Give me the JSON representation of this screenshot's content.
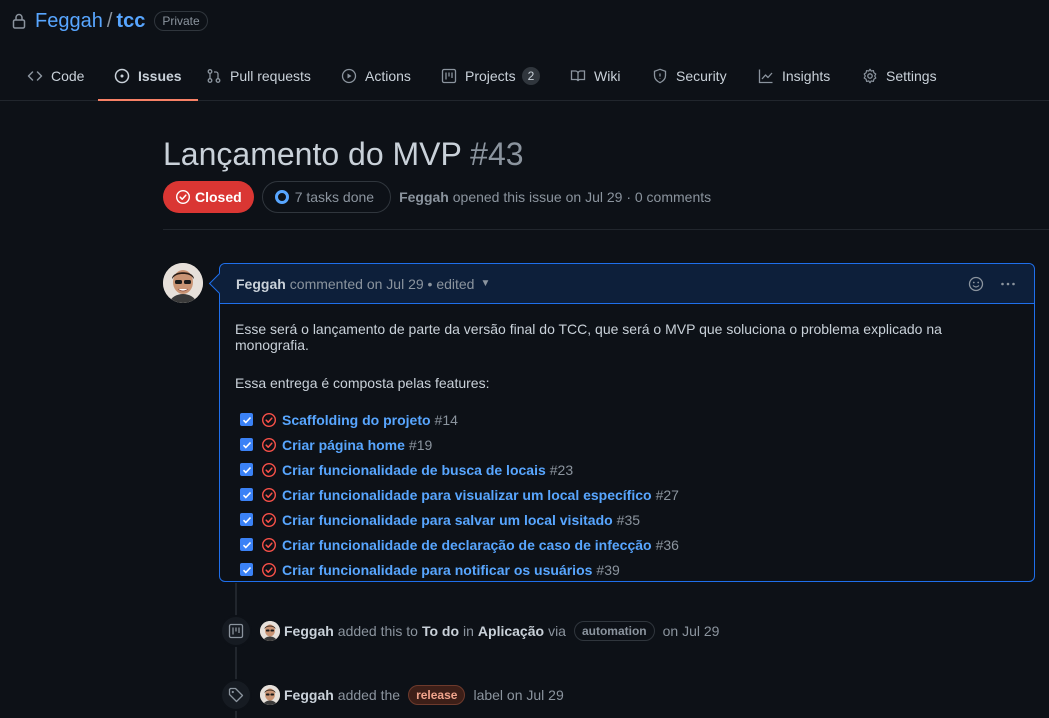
{
  "repo": {
    "owner": "Feggah",
    "separator": "/",
    "name": "tcc",
    "visibility": "Private"
  },
  "nav": {
    "tabs": [
      {
        "label": "Code",
        "icon": "code-icon"
      },
      {
        "label": "Issues",
        "icon": "issue-opened-icon",
        "active": true
      },
      {
        "label": "Pull requests",
        "icon": "git-pull-request-icon"
      },
      {
        "label": "Actions",
        "icon": "play-icon"
      },
      {
        "label": "Projects",
        "icon": "project-icon",
        "count": "2"
      },
      {
        "label": "Wiki",
        "icon": "book-icon"
      },
      {
        "label": "Security",
        "icon": "shield-icon"
      },
      {
        "label": "Insights",
        "icon": "graph-icon"
      },
      {
        "label": "Settings",
        "icon": "gear-icon"
      }
    ]
  },
  "issue": {
    "title": "Lançamento do MVP",
    "number": "#43",
    "state": "Closed",
    "tasks": "7 tasks done",
    "author": "Feggah",
    "opened_text": "opened this issue on Jul 29 · 0 comments"
  },
  "comment": {
    "author": "Feggah",
    "when": "commented on Jul 29 • edited",
    "paragraph1": "Esse será o lançamento de parte da versão final do TCC, que será o MVP que soluciona o problema explicado na monografia.",
    "paragraph2": "Essa entrega é composta pelas features:",
    "tasks": [
      {
        "label": "Scaffolding do projeto",
        "ref": "#14"
      },
      {
        "label": "Criar página home",
        "ref": "#19"
      },
      {
        "label": "Criar funcionalidade de busca de locais",
        "ref": "#23"
      },
      {
        "label": "Criar funcionalidade para visualizar um local específico",
        "ref": "#27"
      },
      {
        "label": "Criar funcionalidade para salvar um local visitado",
        "ref": "#35"
      },
      {
        "label": "Criar funcionalidade de declaração de caso de infecção",
        "ref": "#36"
      },
      {
        "label": "Criar funcionalidade para notificar os usuários",
        "ref": "#39"
      }
    ]
  },
  "timeline": {
    "event1": {
      "actor": "Feggah",
      "t1": "added this to",
      "column": "To do",
      "t2": "in",
      "project": "Aplicação",
      "t3": "via",
      "pill": "automation",
      "t4": "on Jul 29"
    },
    "event2": {
      "actor": "Feggah",
      "t1": "added the",
      "label": "release",
      "t2": "label on Jul 29"
    }
  },
  "colors": {
    "accent": "#58a6ff",
    "closed": "#da3633",
    "active_tab": "#f78166",
    "release_label": "#f0a48c"
  }
}
